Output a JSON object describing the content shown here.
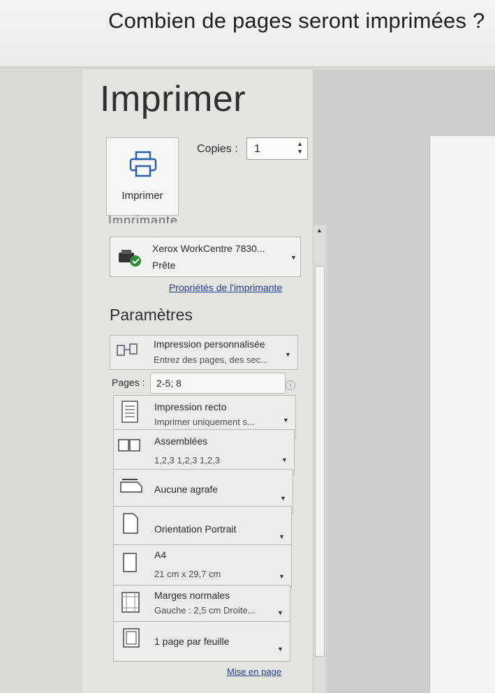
{
  "question": "Combien de pages seront imprimées ?",
  "print": {
    "title": "Imprimer",
    "button_label": "Imprimer",
    "copies_label": "Copies :",
    "copies_value": "1"
  },
  "printer": {
    "section_title": "Imprimante",
    "name": "Xerox WorkCentre 7830...",
    "status": "Prête",
    "properties_link": "Propriétés de l'imprimante"
  },
  "settings": {
    "section_title": "Paramètres",
    "print_range": {
      "title": "Impression personnalisée",
      "subtitle": "Entrez des pages, des sec..."
    },
    "pages": {
      "label": "Pages :",
      "value": "2-5; 8"
    },
    "sides": {
      "title": "Impression recto",
      "subtitle": "Imprimer uniquement s..."
    },
    "collation": {
      "title": "Assemblées",
      "subtitle": "1,2,3    1,2,3    1,2,3"
    },
    "staple": {
      "title": "Aucune agrafe"
    },
    "orientation": {
      "title": "Orientation Portrait"
    },
    "paper": {
      "title": "A4",
      "subtitle": "21 cm x 29,7 cm"
    },
    "margins": {
      "title": "Marges normales",
      "subtitle": "Gauche : 2,5 cm   Droite..."
    },
    "per_sheet": {
      "title": "1 page par feuille"
    },
    "page_setup_link": "Mise en page"
  }
}
